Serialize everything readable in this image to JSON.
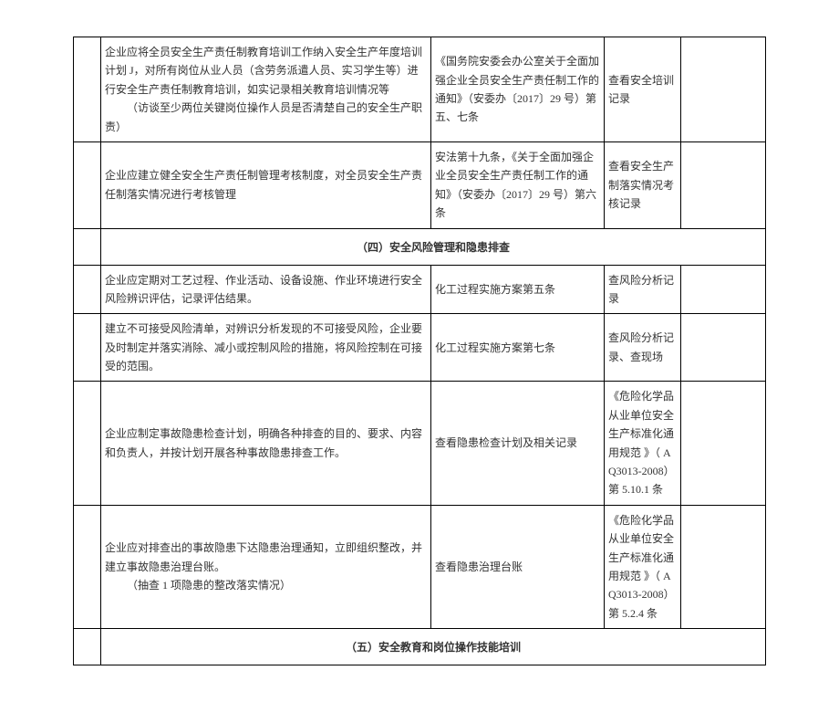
{
  "rows": [
    {
      "desc": "企业应将全员安全生产责任制教育培训工作纳入安全生产年度培训计划 J，对所有岗位从业人员（含劳务派遣人员、实习学生等）进行安全生产责任制教育培训，如实记录相关教育培训情况等",
      "desc_sub": "（访谈至少两位关键岗位操作人员是否清楚自己的安全生产职责）",
      "basis": "《国务院安委会办公室关于全面加强企业全员安全生产责任制工作的通知》（安委办〔2017〕29 号）第五、七条",
      "check": "查看安全培训记录"
    },
    {
      "desc": "企业应建立健全安全生产责任制管理考核制度，对全员安全生产责任制落实情况进行考核管理",
      "basis": "安法第十九条，《关于全面加强企业全员安全生产责任制工作的通知》（安委办〔2017〕29 号）第六条",
      "check": "查看安全生产制落实情况考核记录"
    }
  ],
  "section4": "（四）安全风险管理和隐患排查",
  "rows4": [
    {
      "desc": "企业应定期对工艺过程、作业活动、设备设施、作业环境进行安全风险辨识评估，记录评估结果。",
      "basis": "化工过程实施方案第五条",
      "check": "查风险分析记录"
    },
    {
      "desc": "建立不可接受风险清单，对辨识分析发现的不可接受风险，企业要及时制定并落实消除、减小或控制风险的措施，将风险控制在可接受的范围。",
      "basis": "化工过程实施方案第七条",
      "check": "查风险分析记录、查现场"
    },
    {
      "desc": "企业应制定事故隐患检查计划，明确各种排查的目的、要求、内容和负责人，并按计划开展各种事故隐患排查工作。",
      "basis": "查看隐患检查计划及相关记录",
      "check": "《危险化学品从业单位安全生产标准化通用规范 》（ AQ3013-2008）第 5.10.1 条"
    },
    {
      "desc": "企业应对排查出的事故隐患下达隐患治理通知，立即组织整改，并建立事故隐患治理台账。",
      "desc_sub": "（抽查 1 项隐患的整改落实情况）",
      "basis": "查看隐患治理台账",
      "check": "《危险化学品从业单位安全生产标准化通用规范 》（ AQ3013-2008）第 5.2.4 条"
    }
  ],
  "section5": "（五）安全教育和岗位操作技能培训"
}
